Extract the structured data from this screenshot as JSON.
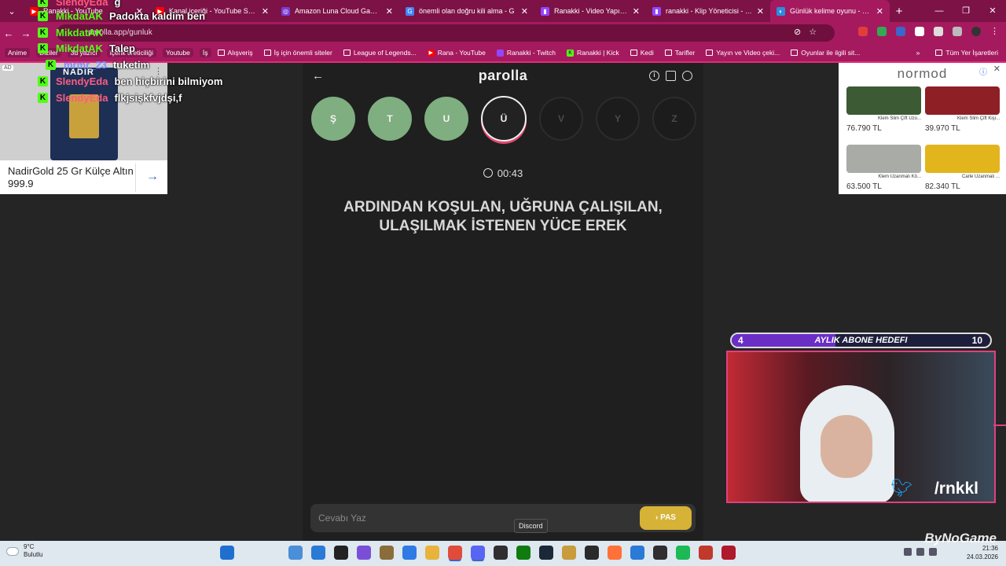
{
  "browser": {
    "tabs": [
      {
        "title": "Ranakki - YouTube",
        "color": "#ff0000",
        "glyph": "▶"
      },
      {
        "title": "Kanal içeriği - YouTube Studio",
        "color": "#ff0000",
        "glyph": "▶"
      },
      {
        "title": "Amazon Luna Cloud Gaming",
        "color": "#7a3bd1",
        "glyph": "◎"
      },
      {
        "title": "önemli olan doğru kili alma - G",
        "color": "#4285f4",
        "glyph": "G"
      },
      {
        "title": "Ranakki - Video Yapımcısı - Twi",
        "color": "#9146ff",
        "glyph": "▮"
      },
      {
        "title": "ranakki - Klip Yöneticisi - Twitch",
        "color": "#9146ff",
        "glyph": "▮"
      },
      {
        "title": "Günlük kelime oyunu - parolla",
        "color": "#2b8de0",
        "glyph": "◐"
      }
    ],
    "url": "parolla.app/gunluk",
    "bookmarks": [
      {
        "label": "Anime",
        "type": "box"
      },
      {
        "label": "Diziler",
        "type": "box"
      },
      {
        "label": "3d yazıcı",
        "type": "box"
      },
      {
        "label": "içerik üreticiliği",
        "type": "box"
      },
      {
        "label": "Youtube",
        "type": "box"
      },
      {
        "label": "İş",
        "type": "box"
      },
      {
        "label": "Alışveriş",
        "type": "folder"
      },
      {
        "label": "İş için önemli siteler",
        "type": "folder"
      },
      {
        "label": "League of Legends...",
        "type": "folder"
      },
      {
        "label": "Rana - YouTube",
        "type": "yt"
      },
      {
        "label": "Ranakki - Twitch",
        "type": "tw"
      },
      {
        "label": "Ranakki | Kick",
        "type": "kick"
      },
      {
        "label": "Kedi",
        "type": "folder"
      },
      {
        "label": "Tarifler",
        "type": "folder"
      },
      {
        "label": "Yayın ve Video çeki...",
        "type": "folder"
      },
      {
        "label": "Oyunlar ile ilgili sit...",
        "type": "folder"
      }
    ],
    "all_bookmarks": "Tüm Yer İşaretleri",
    "accent": "#a51a5e"
  },
  "left_ad": {
    "badge": "AD",
    "brand": "NADIR",
    "text": "NadirGold 25 Gr Külçe Altın 999.9"
  },
  "game": {
    "logo": "parolla",
    "letters": [
      {
        "letter": "Ş",
        "state": "done"
      },
      {
        "letter": "T",
        "state": "done"
      },
      {
        "letter": "U",
        "state": "done"
      },
      {
        "letter": "Ü",
        "state": "current"
      },
      {
        "letter": "V",
        "state": "next"
      },
      {
        "letter": "Y",
        "state": "next"
      },
      {
        "letter": "Z",
        "state": "next"
      }
    ],
    "timer": "00:43",
    "question": "ARDINDAN KOŞULAN, UĞRUNA ÇALIŞILAN, ULAŞILMAK İSTENEN YÜCE EREK",
    "answer_placeholder": "Cevabı Yaz",
    "answer_value": "",
    "pass_label": "PAS",
    "colors": {
      "done": "#7fae80",
      "pass": "#d6b236"
    }
  },
  "tooltip": "Discord",
  "right_ad": {
    "brand": "normod",
    "products": [
      {
        "name": "Klem Slim Çift Uzo...",
        "price": "76.790 TL",
        "color": "#3c5a34"
      },
      {
        "name": "Klem Slim Çift Kişi...",
        "price": "39.970 TL",
        "color": "#8e1f24"
      },
      {
        "name": "Klem Uzanmalı Kö...",
        "price": "63.500 TL",
        "color": "#a9aca6"
      },
      {
        "name": "Carle Uzanmalı ...",
        "price": "82.340 TL",
        "color": "#e2b51d"
      }
    ]
  },
  "chat": [
    {
      "user": "SlendyEda",
      "message": "g",
      "color": "#ff5b82"
    },
    {
      "user": "MikdatAK",
      "message": "Padokta kaldim ben",
      "color": "#53fc18"
    },
    {
      "user": "MikdatAK",
      "message": "",
      "color": "#53fc18"
    },
    {
      "user": "MikdatAK",
      "message": "Talep",
      "color": "#53fc18"
    },
    {
      "user": "mrmr_23",
      "message": "tuketim",
      "color": "#7b8cff"
    },
    {
      "user": "SlendyEda",
      "message": "ben hiçbirini bilmiyom",
      "color": "#ff5b82"
    },
    {
      "user": "SlendyEda",
      "message": "flkjsişkfvjdşi,f",
      "color": "#ff5b82"
    }
  ],
  "sub_goal": {
    "current": "4",
    "label": "AYLIK ABONE HEDEFI",
    "target": "10",
    "progress": 0.4
  },
  "webcam": {
    "handle": "/rnkkl"
  },
  "taskbar": {
    "temperature": "9°C",
    "weather": "Bulutlu",
    "time": "21:36",
    "date": "24.03.2026",
    "icons": [
      "windows-icon",
      "search-icon",
      "taskview-icon",
      "photos-icon",
      "mail-icon",
      "unity-icon",
      "copilot-icon",
      "box-icon",
      "store-icon",
      "files-icon",
      "chrome-icon",
      "discord-icon",
      "obs-icon",
      "xbox-icon",
      "steam-icon",
      "lol-icon",
      "epic-icon",
      "firefox-icon",
      "vpn-icon",
      "obs2-icon",
      "spotify-icon",
      "games-icon",
      "record-icon"
    ]
  },
  "watermark": "ByNoGame"
}
